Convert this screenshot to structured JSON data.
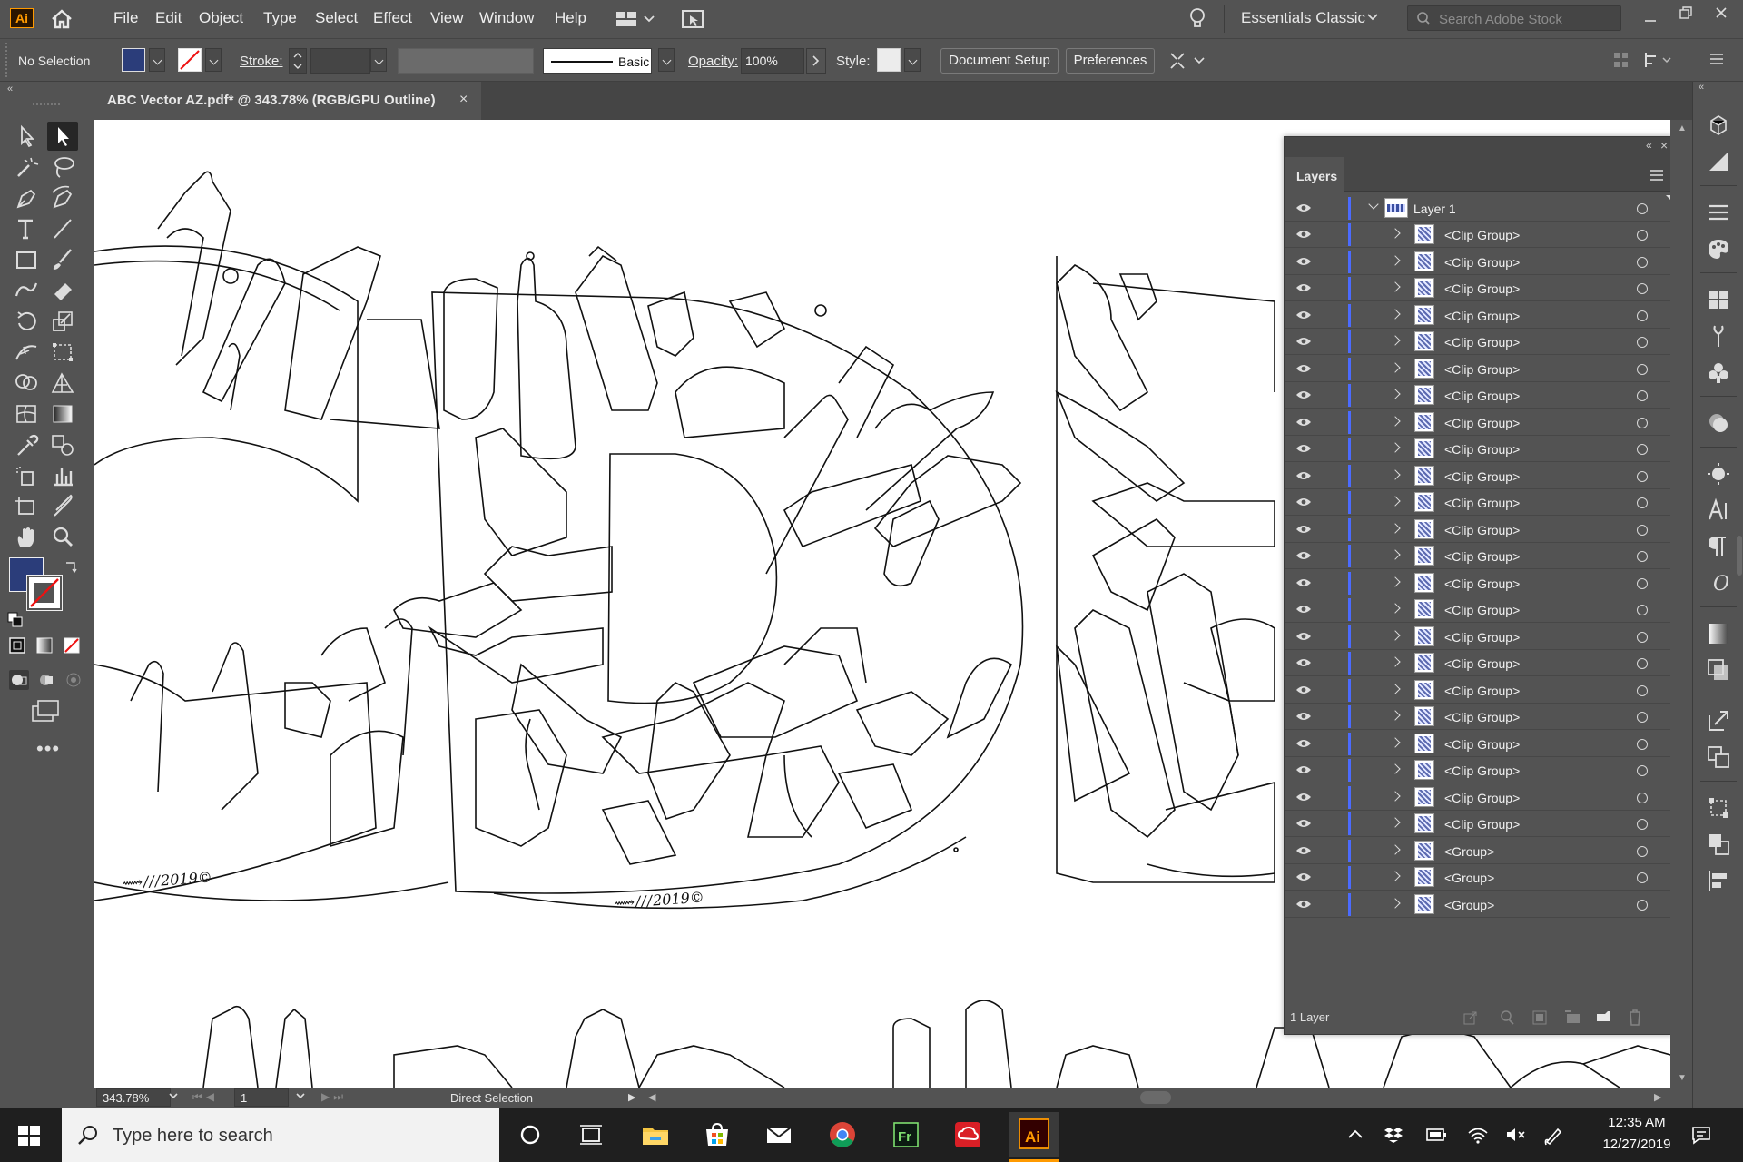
{
  "app": {
    "logo": "Ai",
    "menu": [
      "File",
      "Edit",
      "Object",
      "Type",
      "Select",
      "Effect",
      "View",
      "Window",
      "Help"
    ],
    "workspace": "Essentials Classic",
    "stock_search_placeholder": "Search Adobe Stock"
  },
  "control_bar": {
    "selection": "No Selection",
    "stroke_label": "Stroke:",
    "brush_label": "Basic",
    "opacity_label": "Opacity:",
    "opacity_value": "100%",
    "style_label": "Style:",
    "document_setup": "Document Setup",
    "preferences": "Preferences"
  },
  "document_tab": {
    "title": "ABC Vector AZ.pdf* @ 343.78% (RGB/GPU Outline)",
    "close": "×"
  },
  "colors": {
    "fill": "#2b3d7a",
    "accent": "#4b6bff",
    "ai_orange": "#ff9a00"
  },
  "layers_panel": {
    "title": "Layers",
    "layer_name": "Layer 1",
    "items": [
      "<Clip Group>",
      "<Clip Group>",
      "<Clip Group>",
      "<Clip Group>",
      "<Clip Group>",
      "<Clip Group>",
      "<Clip Group>",
      "<Clip Group>",
      "<Clip Group>",
      "<Clip Group>",
      "<Clip Group>",
      "<Clip Group>",
      "<Clip Group>",
      "<Clip Group>",
      "<Clip Group>",
      "<Clip Group>",
      "<Clip Group>",
      "<Clip Group>",
      "<Clip Group>",
      "<Clip Group>",
      "<Clip Group>",
      "<Clip Group>",
      "<Clip Group>",
      "<Group>",
      "<Group>",
      "<Group>"
    ],
    "footer_count": "1 Layer"
  },
  "status_bar": {
    "zoom": "343.78%",
    "artboard": "1",
    "tool": "Direct Selection"
  },
  "taskbar": {
    "search_placeholder": "Type here to search",
    "time": "12:35 AM",
    "date": "12/27/2019",
    "apps": [
      "task-view",
      "file-explorer",
      "store",
      "mail",
      "chrome",
      "fresco",
      "creative-cloud",
      "illustrator"
    ]
  },
  "artwork": {
    "signature": "2019©"
  }
}
